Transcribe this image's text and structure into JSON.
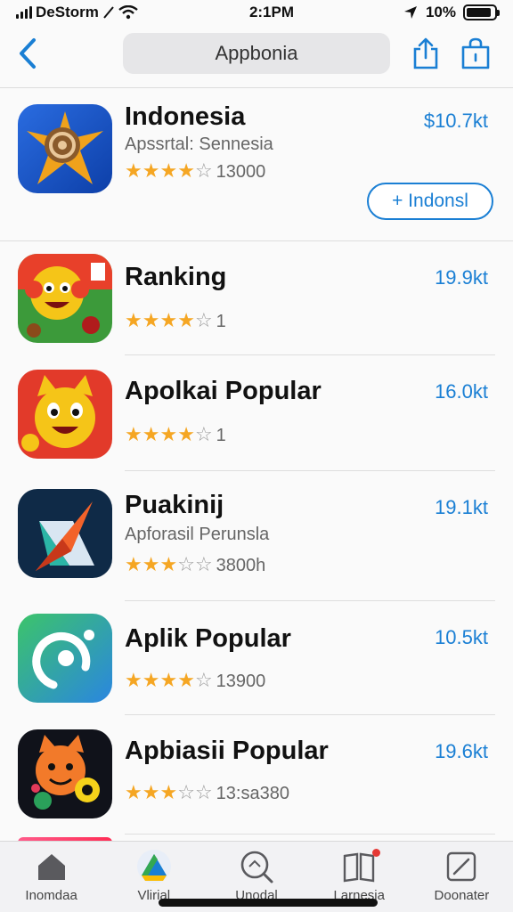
{
  "status_bar": {
    "carrier": "DeStorm",
    "time": "2:1PM",
    "battery": "10%",
    "battery_level": 0.9
  },
  "nav": {
    "search_text": "Appbonia"
  },
  "apps": [
    {
      "title": "Indonesia",
      "subtitle": "Apssrtal: Sennesia",
      "stars_full": 4,
      "stars_total": 5,
      "rating_count": "13000",
      "price": "$10.7kt",
      "button_label": "+ Indonsl",
      "icon": "spiral-star-icon"
    },
    {
      "title": "Ranking",
      "subtitle": "",
      "stars_full": 4,
      "stars_total": 5,
      "rating_count": "1",
      "price": "19.9kt",
      "icon": "cartoon-monkey-icon"
    },
    {
      "title": "Apolkai Popular",
      "subtitle": "",
      "stars_full": 4,
      "stars_total": 5,
      "rating_count": "1",
      "price": "16.0kt",
      "icon": "cartoon-cat-icon"
    },
    {
      "title": "Puakinij",
      "subtitle": "Apforasil Perunsla",
      "stars_full": 3,
      "stars_total": 5,
      "rating_count": "3800h",
      "price": "19.1kt",
      "icon": "paper-plane-icon"
    },
    {
      "title": "Aplik Popular",
      "subtitle": "",
      "stars_full": 4,
      "stars_total": 5,
      "rating_count": "13900",
      "price": "10.5kt",
      "icon": "ring-icon"
    },
    {
      "title": "Apbiasii Popular",
      "subtitle": "",
      "stars_full": 3,
      "stars_total": 5,
      "rating_count": "13:sa380",
      "price": "19.6kt",
      "icon": "cartoon-fox-icon"
    }
  ],
  "tabs": [
    {
      "label": "Inomdaa",
      "icon": "home-icon"
    },
    {
      "label": "Vlirial",
      "icon": "drive-triangle-icon"
    },
    {
      "label": "Unodal",
      "icon": "search-icon"
    },
    {
      "label": "Larnesia",
      "icon": "book-icon",
      "badge": true
    },
    {
      "label": "Doonater",
      "icon": "edit-icon"
    }
  ],
  "colors": {
    "accent": "#1a7fd4",
    "star": "#f5a623",
    "badge": "#e53935"
  }
}
